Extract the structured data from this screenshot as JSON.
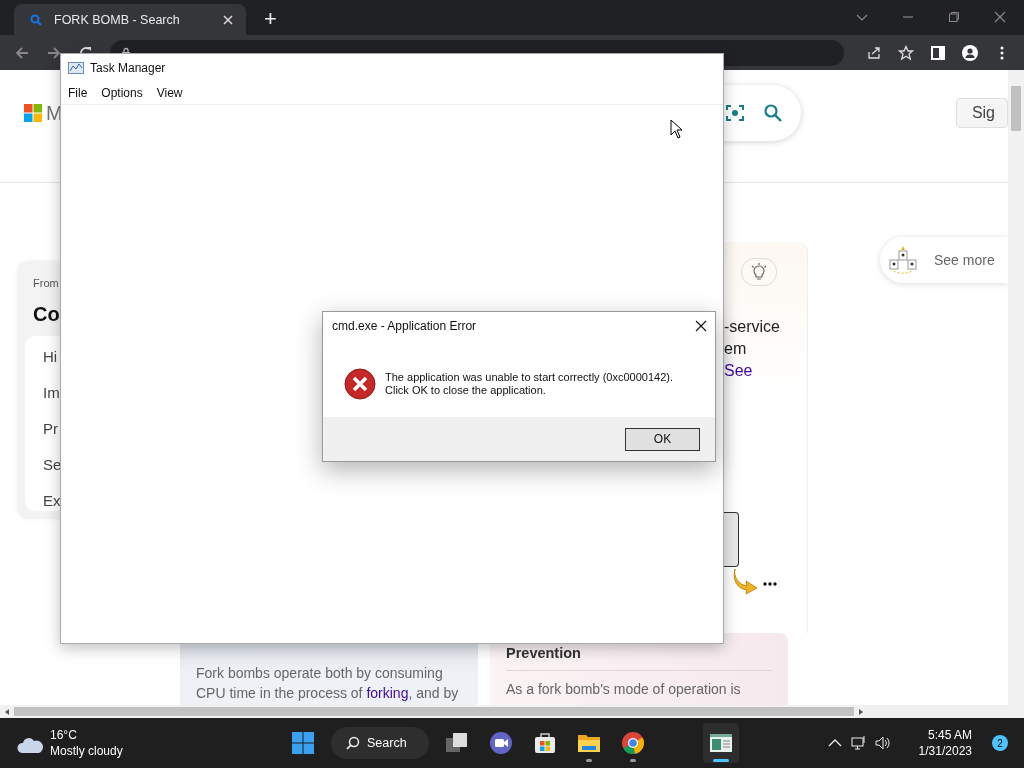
{
  "browser": {
    "tabs": [
      {
        "title": "FORK BOMB - Search",
        "selected": true
      }
    ],
    "new_tab": "+"
  },
  "page": {
    "logo_text": "M",
    "sign_in": "Sig",
    "left_card": {
      "source": "From",
      "title": "Co",
      "items": [
        "Hi",
        "Im",
        "Pr",
        "Se",
        "Ex"
      ]
    },
    "middle_card": {
      "lines": [
        "-service",
        "em"
      ],
      "link": "See"
    },
    "see_more": "See more",
    "sections": [
      {
        "kind": "plain",
        "before": "Fork bombs operate both by consuming CPU time in the process of ",
        "link": "forking",
        "after": ", and by"
      },
      {
        "kind": "heading",
        "heading": "Prevention",
        "text": "As a fork bomb's mode of operation is"
      }
    ]
  },
  "task_manager": {
    "title": "Task Manager",
    "menu": [
      "File",
      "Options",
      "View"
    ]
  },
  "dialog": {
    "title": "cmd.exe - Application Error",
    "lines": [
      "The application was unable to start correctly (0xc0000142).",
      "Click OK to close the application."
    ],
    "button": "OK"
  },
  "taskbar": {
    "temperature": "16°C",
    "condition": "Mostly cloudy",
    "search": "Search",
    "apps": [
      {
        "kind": "taskview",
        "running": false,
        "selected": false
      },
      {
        "kind": "teams",
        "running": false,
        "selected": false
      },
      {
        "kind": "store",
        "running": false,
        "selected": false
      },
      {
        "kind": "explorer",
        "running": true,
        "selected": false
      },
      {
        "kind": "chrome",
        "running": true,
        "selected": false
      },
      {
        "kind": "taskmanager",
        "running": true,
        "selected": true
      }
    ],
    "time": "5:45 AM",
    "date": "1/31/2023",
    "notifications": "2"
  }
}
